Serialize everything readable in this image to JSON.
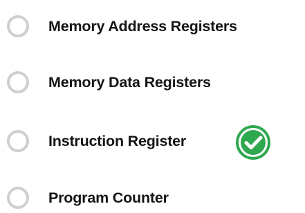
{
  "question": {
    "options": [
      {
        "label": "Memory Address Registers",
        "selected": false,
        "correct": false
      },
      {
        "label": "Memory Data Registers",
        "selected": false,
        "correct": false
      },
      {
        "label": "Instruction Register",
        "selected": false,
        "correct": true
      },
      {
        "label": "Program Counter",
        "selected": false,
        "correct": false
      }
    ],
    "correct_indicator": {
      "icon": "check-circle-icon",
      "color": "#2fa84f"
    }
  },
  "colors": {
    "radio_border": "#cfcfcf",
    "text": "#141414",
    "check_green": "#2fa84f"
  }
}
